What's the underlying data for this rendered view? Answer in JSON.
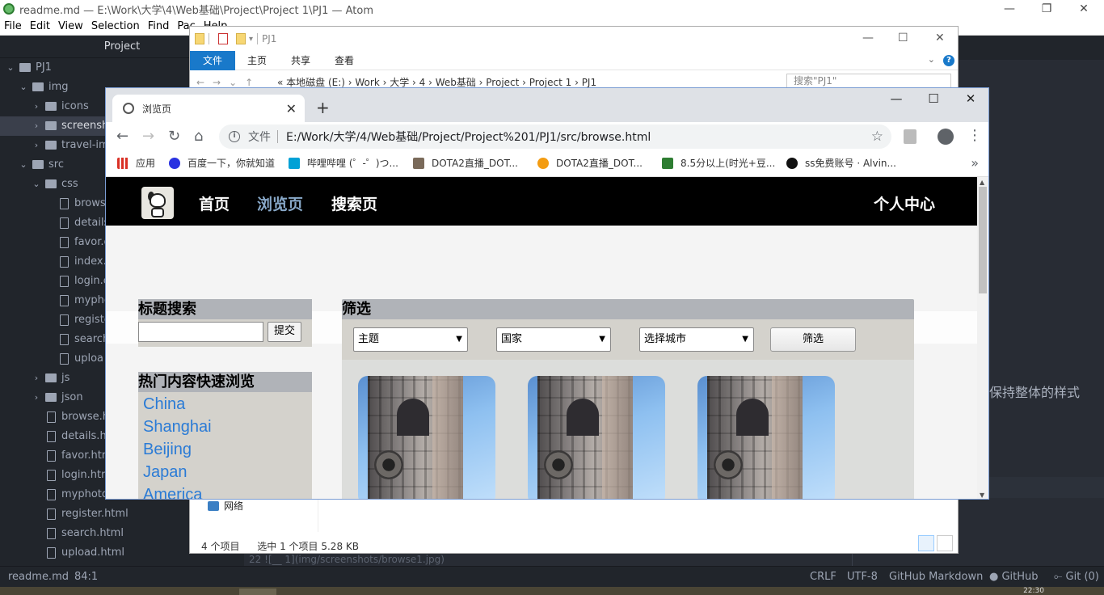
{
  "atom": {
    "title": "readme.md — E:\\Work\\大学\\4\\Web基础\\Project\\Project 1\\PJ1 — Atom",
    "menu": [
      "File",
      "Edit",
      "View",
      "Selection",
      "Find",
      "Pac",
      "Help"
    ],
    "controls": {
      "minimize": "—",
      "restore": "❐",
      "close": "✕"
    },
    "tree_header": "Project",
    "tree": [
      {
        "label": "PJ1",
        "type": "folder",
        "depth": 0,
        "open": true
      },
      {
        "label": "img",
        "type": "folder",
        "depth": 1,
        "open": true
      },
      {
        "label": "icons",
        "type": "folder",
        "depth": 2,
        "open": false
      },
      {
        "label": "screensho",
        "type": "folder",
        "depth": 2,
        "open": false,
        "selected": true
      },
      {
        "label": "travel-ima",
        "type": "folder",
        "depth": 2,
        "open": false
      },
      {
        "label": "src",
        "type": "folder",
        "depth": 1,
        "open": true
      },
      {
        "label": "css",
        "type": "folder",
        "depth": 2,
        "open": true
      },
      {
        "label": "brows",
        "type": "file",
        "depth": 3
      },
      {
        "label": "details",
        "type": "file",
        "depth": 3
      },
      {
        "label": "favor.c",
        "type": "file",
        "depth": 3
      },
      {
        "label": "index.c",
        "type": "file",
        "depth": 3
      },
      {
        "label": "login.c",
        "type": "file",
        "depth": 3
      },
      {
        "label": "myphc",
        "type": "file",
        "depth": 3
      },
      {
        "label": "registe",
        "type": "file",
        "depth": 3
      },
      {
        "label": "search",
        "type": "file",
        "depth": 3
      },
      {
        "label": "uploa",
        "type": "file",
        "depth": 3
      },
      {
        "label": "js",
        "type": "folder",
        "depth": 2,
        "open": false
      },
      {
        "label": "json",
        "type": "folder",
        "depth": 2,
        "open": false
      },
      {
        "label": "browse.h",
        "type": "file",
        "depth": 2
      },
      {
        "label": "details.ht",
        "type": "file",
        "depth": 2
      },
      {
        "label": "favor.htm",
        "type": "file",
        "depth": 2
      },
      {
        "label": "login.htm",
        "type": "file",
        "depth": 2
      },
      {
        "label": "myphoto.html",
        "type": "file",
        "depth": 2
      },
      {
        "label": "register.html",
        "type": "file",
        "depth": 2
      },
      {
        "label": "search.html",
        "type": "file",
        "depth": 2
      },
      {
        "label": "upload.html",
        "type": "file",
        "depth": 2
      }
    ],
    "editor_right_text": "保持整体的样式",
    "editor_bottom_code": "22    ![__  1](img/screenshots/browse1.jpg)",
    "status": {
      "file": "readme.md",
      "cursor": "84:1",
      "line_ending": "CRLF",
      "encoding": "UTF-8",
      "grammar": "GitHub Markdown",
      "github": "GitHub",
      "git": "Git (0)"
    },
    "taskbar_clock": "22:30"
  },
  "explorer": {
    "title": "PJ1",
    "ribbon_tabs": [
      "文件",
      "主页",
      "共享",
      "查看"
    ],
    "address": "«  本地磁盘 (E:)  ›  Work  ›  大学  ›  4  ›  Web基础  ›  Project  ›  Project 1  ›  PJ1",
    "search_placeholder": "搜索\"PJ1\"",
    "network_label": "网络",
    "item_count": "4 个项目",
    "selection_info": "选中 1 个项目  5.28 KB"
  },
  "chrome": {
    "tab_title": "浏览页",
    "url_label": "文件",
    "url": "E:/Work/大学/4/Web基础/Project/Project%201/PJ1/src/browse.html",
    "bookmarks": [
      {
        "label": "应用",
        "color": "#d93025"
      },
      {
        "label": "百度一下，你就知道",
        "color": "#2932e1"
      },
      {
        "label": "哔哩哔哩 (゜-゜)つ...",
        "color": "#00a1d6"
      },
      {
        "label": "DOTA2直播_DOT...",
        "color": "#7a6a5a"
      },
      {
        "label": "DOTA2直播_DOT...",
        "color": "#f39c12"
      },
      {
        "label": "8.5分以上(时光+豆...",
        "color": "#2e7d32"
      },
      {
        "label": "ss免费账号 · Alvin...",
        "color": "#111111"
      }
    ],
    "bookmarks_more": "»"
  },
  "site": {
    "nav": [
      "首页",
      "浏览页",
      "搜索页"
    ],
    "active_nav": "浏览页",
    "user": "个人中心",
    "title_search_header": "标题搜索",
    "search_button": "提交",
    "hot_header": "热门内容快速浏览",
    "hot_links": [
      "China",
      "Shanghai",
      "Beijing",
      "Japan",
      "America"
    ],
    "filter_header": "筛选",
    "filter_selects": [
      "主题",
      "国家",
      "选择城市"
    ],
    "filter_button": "筛选",
    "photo_count": 3
  },
  "colors": {
    "atom_bg": "#282c34",
    "atom_panel": "#21252b",
    "site_nav": "#000000",
    "active_nav": "#88a8c8",
    "link": "#2a7bd6",
    "explorer_accent": "#1979ca"
  }
}
